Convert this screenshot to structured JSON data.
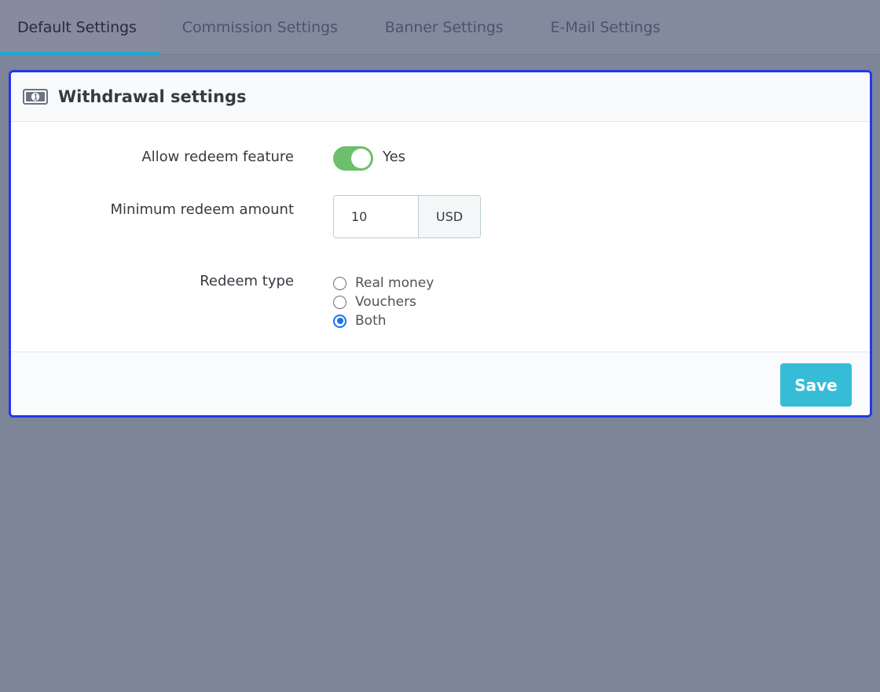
{
  "tabs": [
    {
      "label": "Default Settings",
      "active": true
    },
    {
      "label": "Commission Settings",
      "active": false
    },
    {
      "label": "Banner Settings",
      "active": false
    },
    {
      "label": "E-Mail Settings",
      "active": false
    }
  ],
  "panel": {
    "icon": "money-icon",
    "title": "Withdrawal settings",
    "allow_redeem": {
      "label": "Allow redeem feature",
      "value": "Yes",
      "enabled": true
    },
    "min_amount": {
      "label": "Minimum redeem amount",
      "value": "10",
      "currency": "USD"
    },
    "redeem_type": {
      "label": "Redeem type",
      "options": [
        {
          "label": "Real money",
          "checked": false
        },
        {
          "label": "Vouchers",
          "checked": false
        },
        {
          "label": "Both",
          "checked": true
        }
      ]
    },
    "save_label": "Save"
  },
  "colors": {
    "accent": "#25a6cc",
    "toggle_on": "#6dbf6d",
    "save_button": "#37bcd8",
    "panel_border": "#2437ee",
    "radio_checked": "#1a73e8"
  }
}
